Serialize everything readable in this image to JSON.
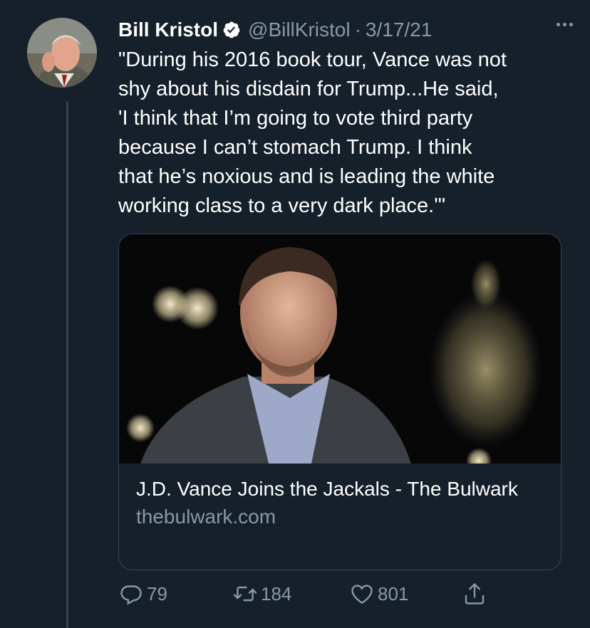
{
  "tweet": {
    "author_name": "Bill Kristol",
    "handle": "@BillKristol",
    "separator": "·",
    "date": "3/17/21",
    "text": "\"During his 2016 book tour, Vance was not\nshy about his disdain for Trump...He said,\n'I think that I’m going to vote third party\nbecause I can’t stomach Trump. I think\nthat he’s noxious and is leading the white\nworking class to a very dark place.'\""
  },
  "card": {
    "title": "J.D. Vance Joins the Jackals - The Bulwark",
    "domain": "thebulwark.com"
  },
  "actions": {
    "reply_count": "79",
    "retweet_count": "184",
    "like_count": "801"
  },
  "icons": {
    "verified": "verified-badge-icon",
    "more": "more-horizontal-icon",
    "reply": "reply-icon",
    "retweet": "retweet-icon",
    "like": "heart-icon",
    "share": "share-icon"
  },
  "colors": {
    "background": "#15202b",
    "secondary_text": "#8899a6",
    "border": "#38444d"
  }
}
